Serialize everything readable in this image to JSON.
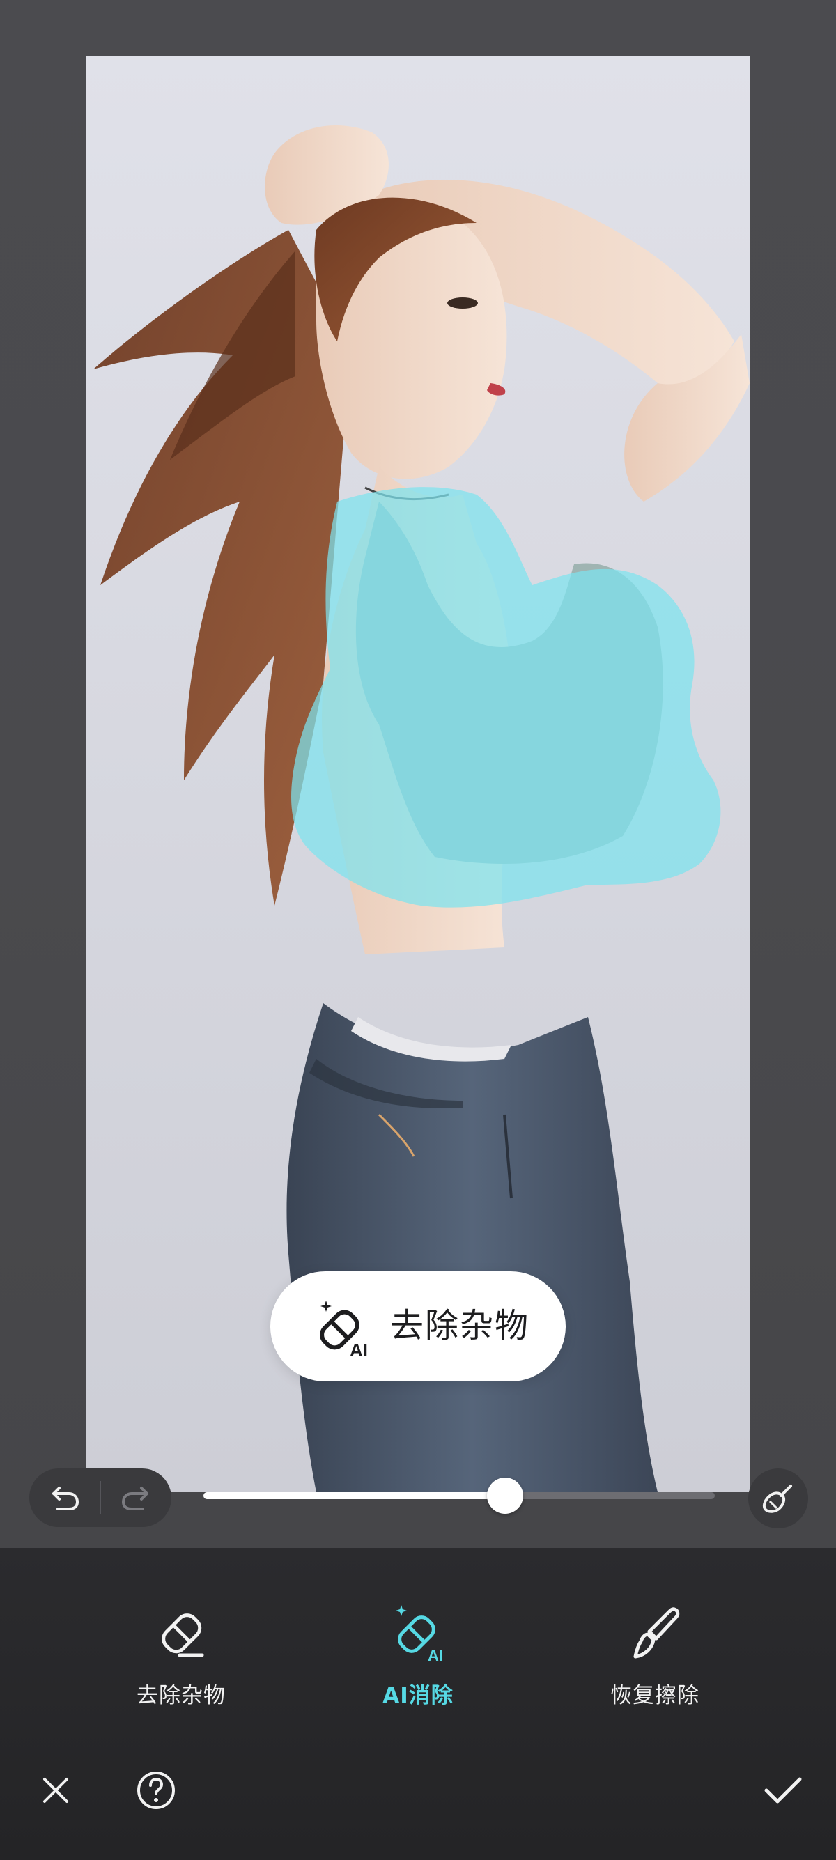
{
  "editor": {
    "brush_size": 0.59,
    "selection_color": "#7de3ee",
    "accent_color": "#56d9e4"
  },
  "floating_tool": {
    "label": "去除杂物",
    "icon": "ai-eraser-icon",
    "badge": "AI"
  },
  "history": {
    "undo_icon": "undo-icon",
    "redo_icon": "redo-icon"
  },
  "clear_icon": "broom-icon",
  "modes": [
    {
      "label": "去除杂物",
      "icon": "eraser-icon",
      "active": false
    },
    {
      "label": "AI消除",
      "icon": "ai-eraser-icon",
      "badge": "AI",
      "active": true
    },
    {
      "label": "恢复擦除",
      "icon": "brush-icon",
      "active": false
    }
  ],
  "footer": {
    "close_icon": "close-icon",
    "help_icon": "help-icon",
    "confirm_icon": "checkmark-icon"
  }
}
